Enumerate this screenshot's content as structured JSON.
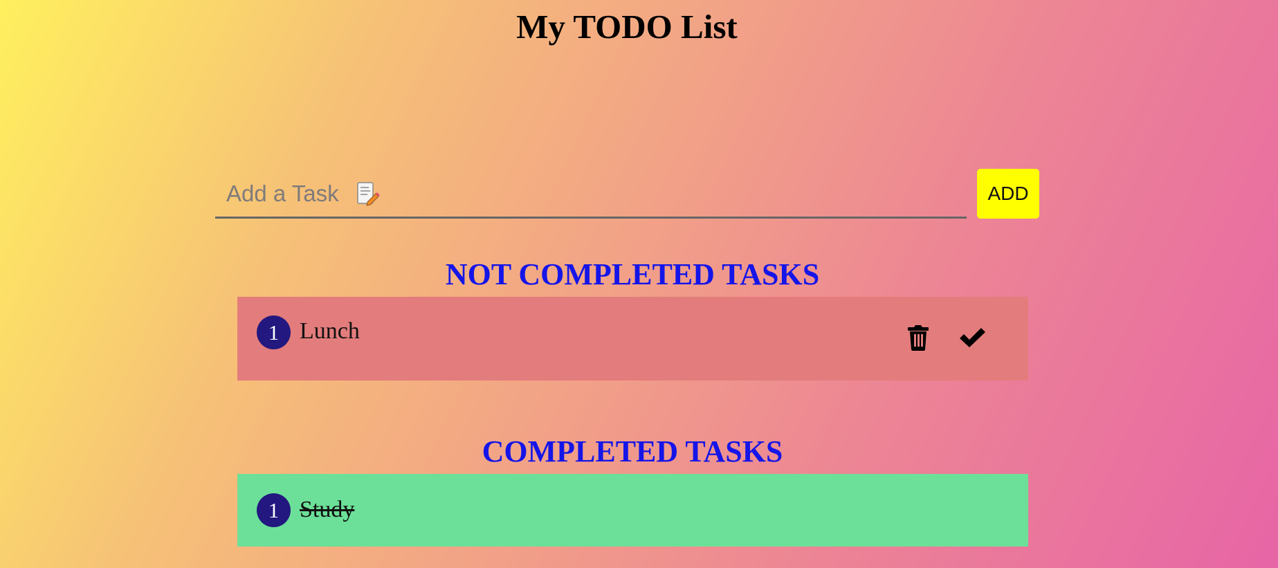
{
  "page": {
    "title": "My TODO List"
  },
  "input": {
    "placeholder": "Add a Task",
    "value": "",
    "icon": "pencil-notepad-icon",
    "add_label": "ADD"
  },
  "sections": {
    "pending_title": "NOT COMPLETED TASKS",
    "completed_title": "COMPLETED TASKS"
  },
  "pending_tasks": [
    {
      "number": "1",
      "text": "Lunch",
      "delete_icon": "trash-icon",
      "complete_icon": "check-icon"
    }
  ],
  "completed_tasks": [
    {
      "number": "1",
      "text": "Study"
    }
  ],
  "colors": {
    "title": "#000000",
    "section_title": "#1515e8",
    "add_button": "#ffff00",
    "pending_card": "#e37c7c",
    "completed_card": "#6ce098",
    "task_number": "#22187f"
  }
}
